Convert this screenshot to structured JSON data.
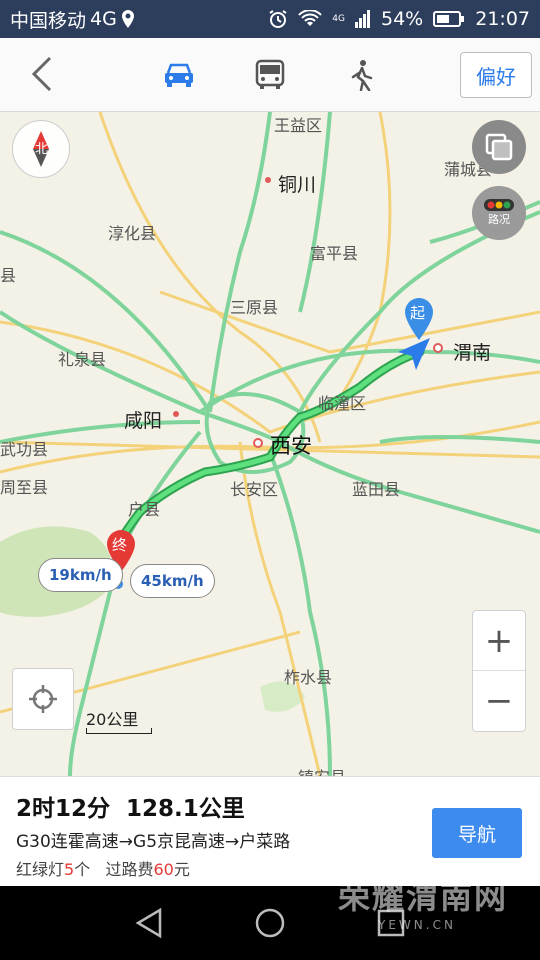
{
  "status_bar": {
    "carrier": "中国移动",
    "network": "4G",
    "signal_tag": "4G",
    "battery": "54%",
    "time": "21:07"
  },
  "top_nav": {
    "modes": [
      "car-icon",
      "bus-icon",
      "walk-icon"
    ],
    "active_mode": "car",
    "accent_color": "#2b7be8",
    "preference_label": "偏好"
  },
  "map": {
    "labels": {
      "wangyi": "王益区",
      "tongchuan": "铜川",
      "puchengxian": "蒲城县",
      "chunhua": "淳化县",
      "fuping": "富平县",
      "xian_left": "县",
      "sanyuan": "三原县",
      "liquan": "礼泉县",
      "weinan": "渭南",
      "lintong": "临潼区",
      "xianyang": "咸阳",
      "xian": "西安",
      "wugong": "武功县",
      "zhouzhi": "周至县",
      "huxian": "户县",
      "changan": "长安区",
      "lantian": "蓝田县",
      "zhashui": "柞水县",
      "zhenan": "镇安县"
    },
    "compass_label": "北",
    "traffic_label": "路况",
    "start_marker": "起",
    "end_marker": "终",
    "speed_left": "19km/h",
    "speed_right": "45km/h",
    "scale_label": "20公里",
    "zoom_in": "+",
    "zoom_out": "−"
  },
  "route_card": {
    "duration": "2时12分",
    "distance": "128.1公里",
    "roads": "G30连霍高速→G5京昆高速→户菜路",
    "traffic_lights_prefix": "红绿灯",
    "traffic_lights_count": "5",
    "traffic_lights_suffix": "个",
    "toll_prefix": "过路费",
    "toll_amount": "60",
    "toll_suffix": "元",
    "navigate_label": "导航",
    "accent_color": "#3d8bef"
  },
  "watermark": {
    "line1": "荣耀渭南网",
    "line2": "YEWN.CN"
  }
}
